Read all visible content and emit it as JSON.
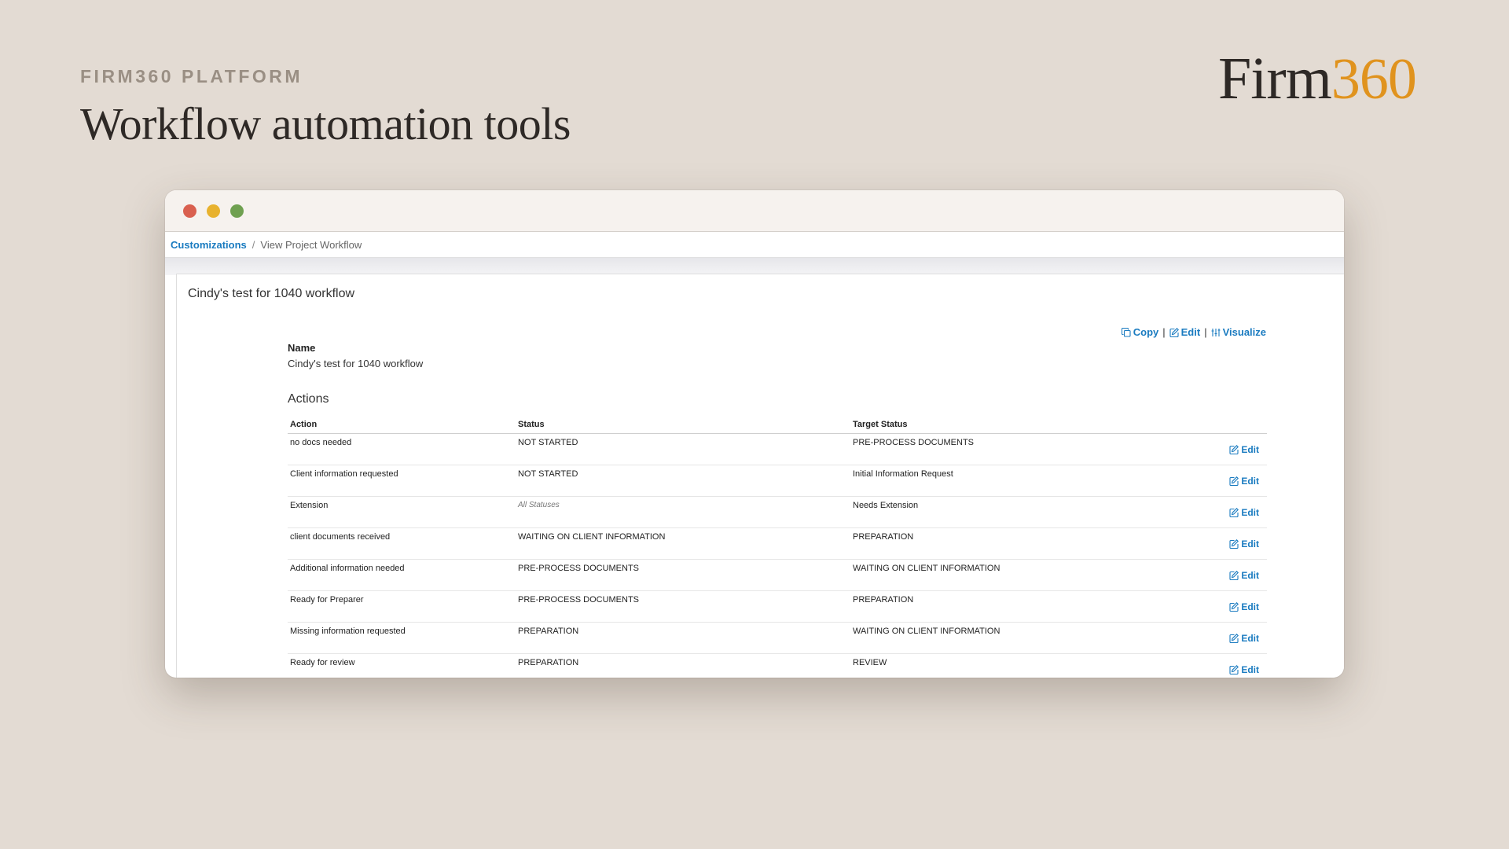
{
  "header": {
    "eyebrow": "FIRM360 PLATFORM",
    "headline": "Workflow automation tools"
  },
  "logo": {
    "part1": "Firm",
    "part2": "360"
  },
  "colors": {
    "background": "#e3dbd3",
    "accent": "#e0931e",
    "link": "#1a7bc0",
    "traffic_close": "#d9604f",
    "traffic_min": "#e8b22e",
    "traffic_max": "#6fa050"
  },
  "breadcrumb": {
    "root": "Customizations",
    "separator": "/",
    "current": "View Project Workflow"
  },
  "panel": {
    "title": "Cindy's test for 1040 workflow",
    "toolbar": {
      "copy": "Copy",
      "edit": "Edit",
      "visualize": "Visualize",
      "separator": "|"
    },
    "name_label": "Name",
    "name_value": "Cindy's test for 1040 workflow",
    "actions_heading": "Actions"
  },
  "table": {
    "headers": [
      "Action",
      "Status",
      "Target Status",
      ""
    ],
    "edit_label": "Edit",
    "rows": [
      {
        "action": "no docs needed",
        "status": "NOT STARTED",
        "status_muted": false,
        "target": "PRE-PROCESS DOCUMENTS"
      },
      {
        "action": "Client information requested",
        "status": "NOT STARTED",
        "status_muted": false,
        "target": "Initial Information Request"
      },
      {
        "action": "Extension",
        "status": "All Statuses",
        "status_muted": true,
        "target": "Needs Extension"
      },
      {
        "action": "client documents received",
        "status": "WAITING ON CLIENT INFORMATION",
        "status_muted": false,
        "target": "PREPARATION"
      },
      {
        "action": "Additional information needed",
        "status": "PRE-PROCESS DOCUMENTS",
        "status_muted": false,
        "target": "WAITING ON CLIENT INFORMATION"
      },
      {
        "action": "Ready for Preparer",
        "status": "PRE-PROCESS DOCUMENTS",
        "status_muted": false,
        "target": "PREPARATION"
      },
      {
        "action": "Missing information requested",
        "status": "PREPARATION",
        "status_muted": false,
        "target": "WAITING ON CLIENT INFORMATION"
      },
      {
        "action": "Ready for review",
        "status": "PREPARATION",
        "status_muted": false,
        "target": "REVIEW"
      }
    ]
  }
}
